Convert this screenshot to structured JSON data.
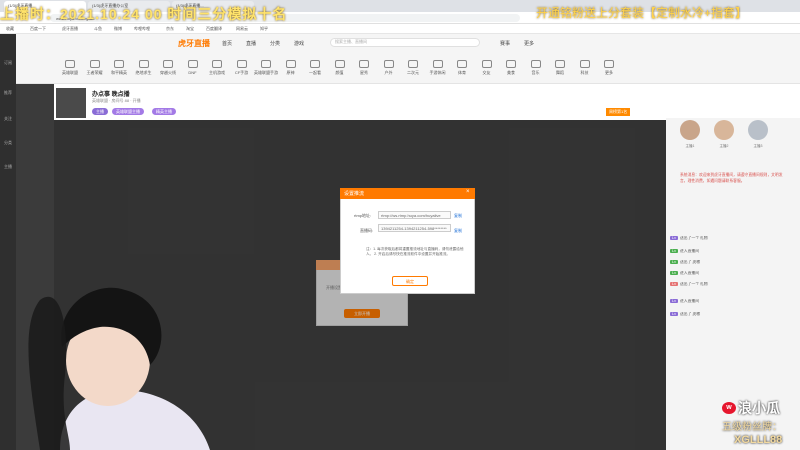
{
  "overlay": {
    "top_left": "上播时：2021.10.24 00 时间三分模拟十名",
    "top_right": "开通铭粉送上分套装【定制水冷+指套】",
    "weibo_name": "浪小瓜",
    "fan_label": "五级粉丝牌：",
    "fan_code": "XGLLL88"
  },
  "browser": {
    "tabs": [
      "(1/3)虎牙直播",
      "(1/3)虎牙直播办公室",
      "(1/3)虎牙直播..."
    ],
    "url": "www.huya.com/xgll88",
    "bookmarks": [
      "收藏",
      "百度一下",
      "虎牙直播",
      "斗鱼",
      "微博",
      "哔哩哔哩",
      "京东",
      "淘宝",
      "百度翻译",
      "网易云",
      "知乎"
    ]
  },
  "site": {
    "logo": "虎牙直播",
    "nav": [
      "首页",
      "直播",
      "分类",
      "游戏",
      "赛事",
      "更多"
    ],
    "search_placeholder": "搜索主播、直播间",
    "categories": [
      "英雄联盟",
      "王者荣耀",
      "和平精英",
      "绝地求生",
      "穿越火线",
      "DNF",
      "主机游戏",
      "CF手游",
      "英雄联盟手游",
      "原神",
      "一起看",
      "颜值",
      "星秀",
      "户外",
      "二次元",
      "手游休闲",
      "体育",
      "交友",
      "美食",
      "音乐",
      "舞蹈",
      "科技",
      "更多"
    ],
    "leftbar": [
      "订阅",
      "推荐",
      "关注",
      "分类",
      "主播"
    ]
  },
  "room": {
    "title": "办点事 晚点播",
    "info": "英雄联盟 · 房间号 88 · 开播",
    "tags": [
      "主播",
      "英雄联盟主播",
      "精英主播"
    ],
    "rank": "周榜第1名"
  },
  "bg_dialog": {
    "text": "开播设置",
    "button": "立即开播"
  },
  "modal": {
    "title": "设置推流",
    "rtmp_label": "rtmp地址:",
    "rtmp_value": "rtmp://ws.rtmp.huya.com/huyalive",
    "rtmp_link": "复制",
    "key_label": "直播码:",
    "key_value": "1394211254-1394211254-598********",
    "key_link": "复制",
    "notes": "注：1. 每次获取后都将重置推流地址与直播码，请勿泄露给他人。 2. 开启后请尽快在推流软件中设置并开始推流。",
    "confirm": "确定"
  },
  "right_panel": {
    "names": [
      "主播1",
      "主播2",
      "主播3"
    ],
    "notice": "系统消息：欢迎来到虎牙直播间，请遵守直播间规则，文明发言，理性消费，如遇问题请联系客服。",
    "messages": [
      "送出了一个 礼物",
      "进入直播间",
      "送出了 虎粮",
      "进入直播间",
      "送出了一个 礼物",
      "进入直播间",
      "送出了 虎粮"
    ]
  },
  "colors": {
    "accent": "#ff7a00",
    "overlay_yellow": "#ffe36b"
  }
}
